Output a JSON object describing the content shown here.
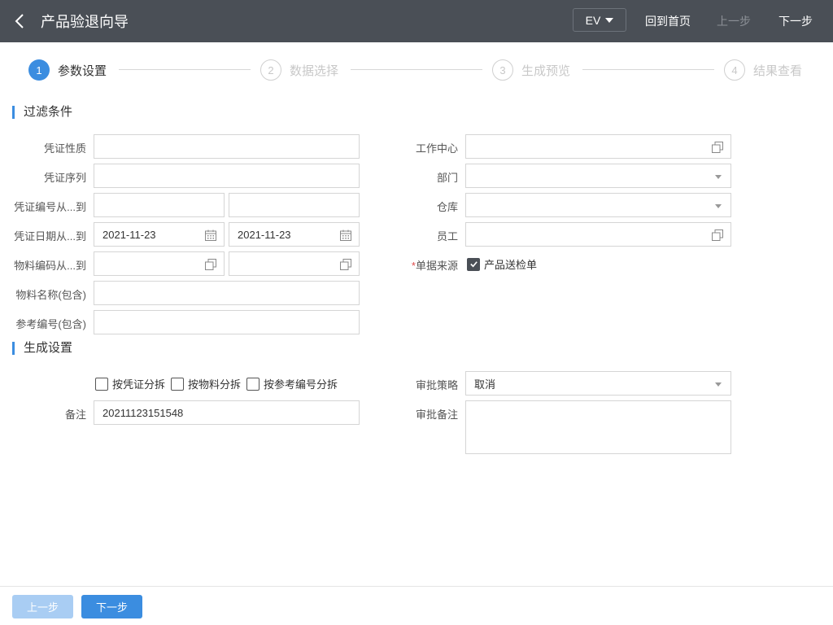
{
  "header": {
    "title": "产品验退向导",
    "lang": "EV",
    "home": "回到首页",
    "prev": "上一步",
    "next": "下一步"
  },
  "steps": [
    {
      "num": "1",
      "label": "参数设置"
    },
    {
      "num": "2",
      "label": "数据选择"
    },
    {
      "num": "3",
      "label": "生成预览"
    },
    {
      "num": "4",
      "label": "结果查看"
    }
  ],
  "filter": {
    "section_title": "过滤条件",
    "voucher_nature_label": "凭证性质",
    "voucher_seq_label": "凭证序列",
    "voucher_no_label": "凭证编号从...到",
    "voucher_date_label": "凭证日期从...到",
    "voucher_date_from": "2021-11-23",
    "voucher_date_to": "2021-11-23",
    "material_code_label": "物料编码从...到",
    "material_name_label": "物料名称(包含)",
    "ref_no_label": "参考编号(包含)",
    "work_center_label": "工作中心",
    "dept_label": "部门",
    "warehouse_label": "仓库",
    "employee_label": "员工",
    "source_req": "*",
    "source_label": "单据来源",
    "source_option": "产品送检单"
  },
  "gen": {
    "section_title": "生成设置",
    "split_voucher": "按凭证分拆",
    "split_material": "按物料分拆",
    "split_ref": "按参考编号分拆",
    "remark_label": "备注",
    "remark_value": "20211123151548",
    "approval_strategy_label": "审批策略",
    "approval_strategy_value": "取消",
    "approval_remark_label": "审批备注"
  },
  "footer": {
    "prev": "上一步",
    "next": "下一步"
  }
}
